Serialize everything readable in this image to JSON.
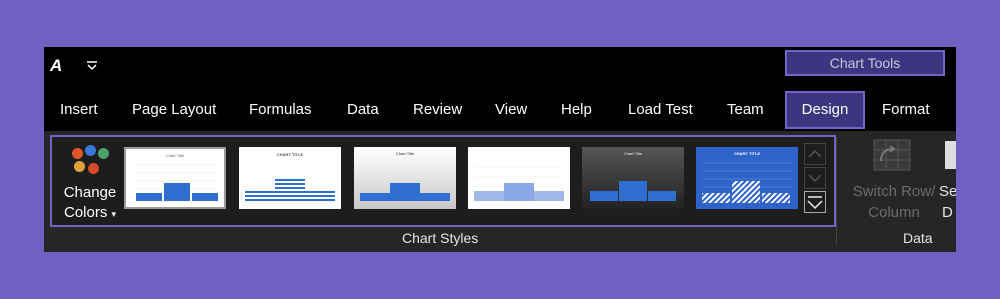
{
  "titlebar": {
    "app_icon": "app-logo-icon",
    "quick_access_icon": "caret-down-icon",
    "contextual_group": "Chart Tools"
  },
  "tabs": [
    "Insert",
    "Page Layout",
    "Formulas",
    "Data",
    "Review",
    "View",
    "Help",
    "Load Test",
    "Team",
    "Design",
    "Format"
  ],
  "active_tab": "Design",
  "ribbon": {
    "change_colors": {
      "line1": "Change",
      "line2": "Colors",
      "dropdown_icon": "caret-down-icon"
    },
    "chart_styles": [
      {
        "title": "Chart Title",
        "style": "light-bars"
      },
      {
        "title": "CHART TITLE",
        "style": "striped-bars"
      },
      {
        "title": "Chart Title",
        "style": "gray-gradient"
      },
      {
        "title": "",
        "style": "light-blue-area"
      },
      {
        "title": "Chart Title",
        "style": "dark-bars"
      },
      {
        "title": "CHART TITLE",
        "style": "hatched-blue"
      }
    ],
    "gallery_scroll_icons": [
      "chevron-up-icon",
      "chevron-down-icon",
      "more-icon"
    ],
    "chart_styles_label": "Chart Styles",
    "switch_row_column": {
      "line1": "Switch Row/",
      "line2": "Column"
    },
    "select_data": {
      "line1": "Se",
      "line2": "D"
    },
    "data_label": "Data"
  },
  "colors": {
    "background": "#6e61c2",
    "window": "#000000",
    "ribbon": "#262626",
    "highlight_border": "#7265c8",
    "highlight_fill": "#3d3580",
    "bar_blue": "#2f6fd1"
  }
}
